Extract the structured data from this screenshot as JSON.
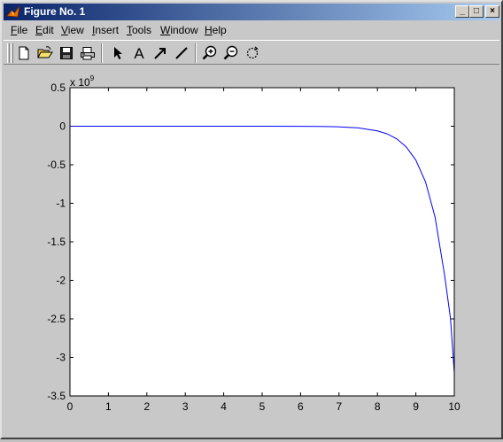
{
  "window": {
    "title": "Figure No. 1",
    "minimize_glyph": "_",
    "maximize_glyph": "□",
    "close_glyph": "×"
  },
  "menu": [
    {
      "key": "file",
      "first": "F",
      "rest": "ile"
    },
    {
      "key": "edit",
      "first": "E",
      "rest": "dit"
    },
    {
      "key": "view",
      "first": "V",
      "rest": "iew"
    },
    {
      "key": "insert",
      "first": "I",
      "rest": "nsert"
    },
    {
      "key": "tools",
      "first": "T",
      "rest": "ools"
    },
    {
      "key": "window",
      "first": "W",
      "rest": "indow"
    },
    {
      "key": "help",
      "first": "H",
      "rest": "elp"
    }
  ],
  "toolbar": {
    "icons": [
      "new-file-icon",
      "open-folder-icon",
      "save-disk-icon",
      "print-icon",
      "select-arrow-icon",
      "insert-text-icon",
      "insert-arrow-icon",
      "insert-line-icon",
      "zoom-in-icon",
      "zoom-out-icon",
      "rotate-3d-icon"
    ],
    "text_tool_label": "A"
  },
  "chart_data": {
    "type": "line",
    "title": "",
    "xlabel": "",
    "ylabel": "",
    "y_exponent_label": "x 10",
    "y_exponent_power": "9",
    "xlim": [
      0,
      10
    ],
    "ylim": [
      -3.5,
      0.5
    ],
    "xticks": [
      "0",
      "1",
      "2",
      "3",
      "4",
      "5",
      "6",
      "7",
      "8",
      "9",
      "10"
    ],
    "yticks": [
      "0.5",
      "0",
      "-0.5",
      "-1",
      "-1.5",
      "-2",
      "-2.5",
      "-3",
      "-3.5"
    ],
    "line_color": "#0000ff",
    "series": [
      {
        "x": [
          0,
          1,
          2,
          3,
          4,
          5,
          6,
          6.5,
          7,
          7.5,
          8,
          8.25,
          8.5,
          8.75,
          9,
          9.25,
          9.5,
          9.75,
          9.9,
          10
        ],
        "values": [
          0,
          0,
          0,
          0,
          0,
          0,
          -0.001,
          -0.003,
          -0.008,
          -0.022,
          -0.06,
          -0.099,
          -0.163,
          -0.268,
          -0.44,
          -0.72,
          -1.18,
          -1.94,
          -2.49,
          -3.2
        ]
      }
    ]
  }
}
